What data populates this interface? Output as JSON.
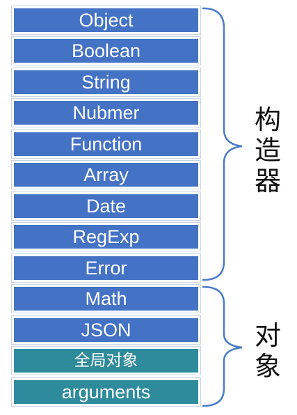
{
  "items": [
    {
      "label": "Object",
      "group": "constructor"
    },
    {
      "label": "Boolean",
      "group": "constructor"
    },
    {
      "label": "String",
      "group": "constructor"
    },
    {
      "label": "Nubmer",
      "group": "constructor"
    },
    {
      "label": "Function",
      "group": "constructor"
    },
    {
      "label": "Array",
      "group": "constructor"
    },
    {
      "label": "Date",
      "group": "constructor"
    },
    {
      "label": "RegExp",
      "group": "constructor"
    },
    {
      "label": "Error",
      "group": "constructor"
    },
    {
      "label": "Math",
      "group": "object"
    },
    {
      "label": "JSON",
      "group": "object"
    },
    {
      "label": "全局对象",
      "group": "object"
    },
    {
      "label": "arguments",
      "group": "object"
    }
  ],
  "groups": {
    "constructor": {
      "label_chars": [
        "构",
        "造",
        "器"
      ]
    },
    "object": {
      "label_chars": [
        "对",
        "象"
      ]
    }
  },
  "colors": {
    "constructor_fill": "#4472c4",
    "teal_fill": "#2e8b9b",
    "brace": "#4a7bc8"
  }
}
